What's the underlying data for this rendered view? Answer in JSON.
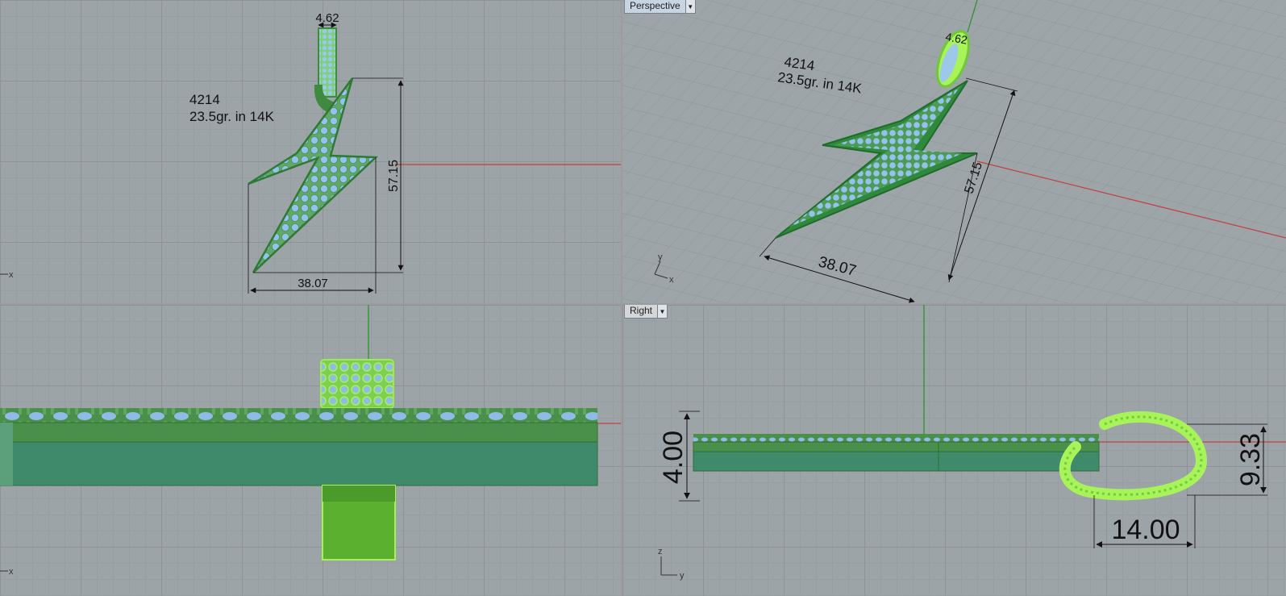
{
  "viewports": {
    "top": {
      "note_line1": "4214",
      "note_line2": "23.5gr. in 14K",
      "dim_ring_width": "4.62",
      "dim_height": "57.15",
      "dim_width": "38.07",
      "axis_x": "x"
    },
    "perspective": {
      "tab_label": "Perspective",
      "note_line1": "4214",
      "note_line2": "23.5gr. in 14K",
      "dim_ring_width": "4.62",
      "dim_height": "57.15",
      "dim_width": "38.07",
      "axis_x": "x",
      "axis_y": "y"
    },
    "front": {
      "axis_x": "x"
    },
    "right": {
      "tab_label": "Right",
      "dim_thickness": "4.00",
      "dim_ring_height": "9.33",
      "dim_ring_depth": "14.00",
      "axis_z": "z",
      "axis_y": "y"
    }
  },
  "colors": {
    "grid_bg": "#9da4a8",
    "body_green": "#3f8a3f",
    "highlight_green": "#a4f04a",
    "stones_blue": "#8fbbe6",
    "axis_red": "#c24040",
    "axis_green": "#2f8f2f"
  }
}
